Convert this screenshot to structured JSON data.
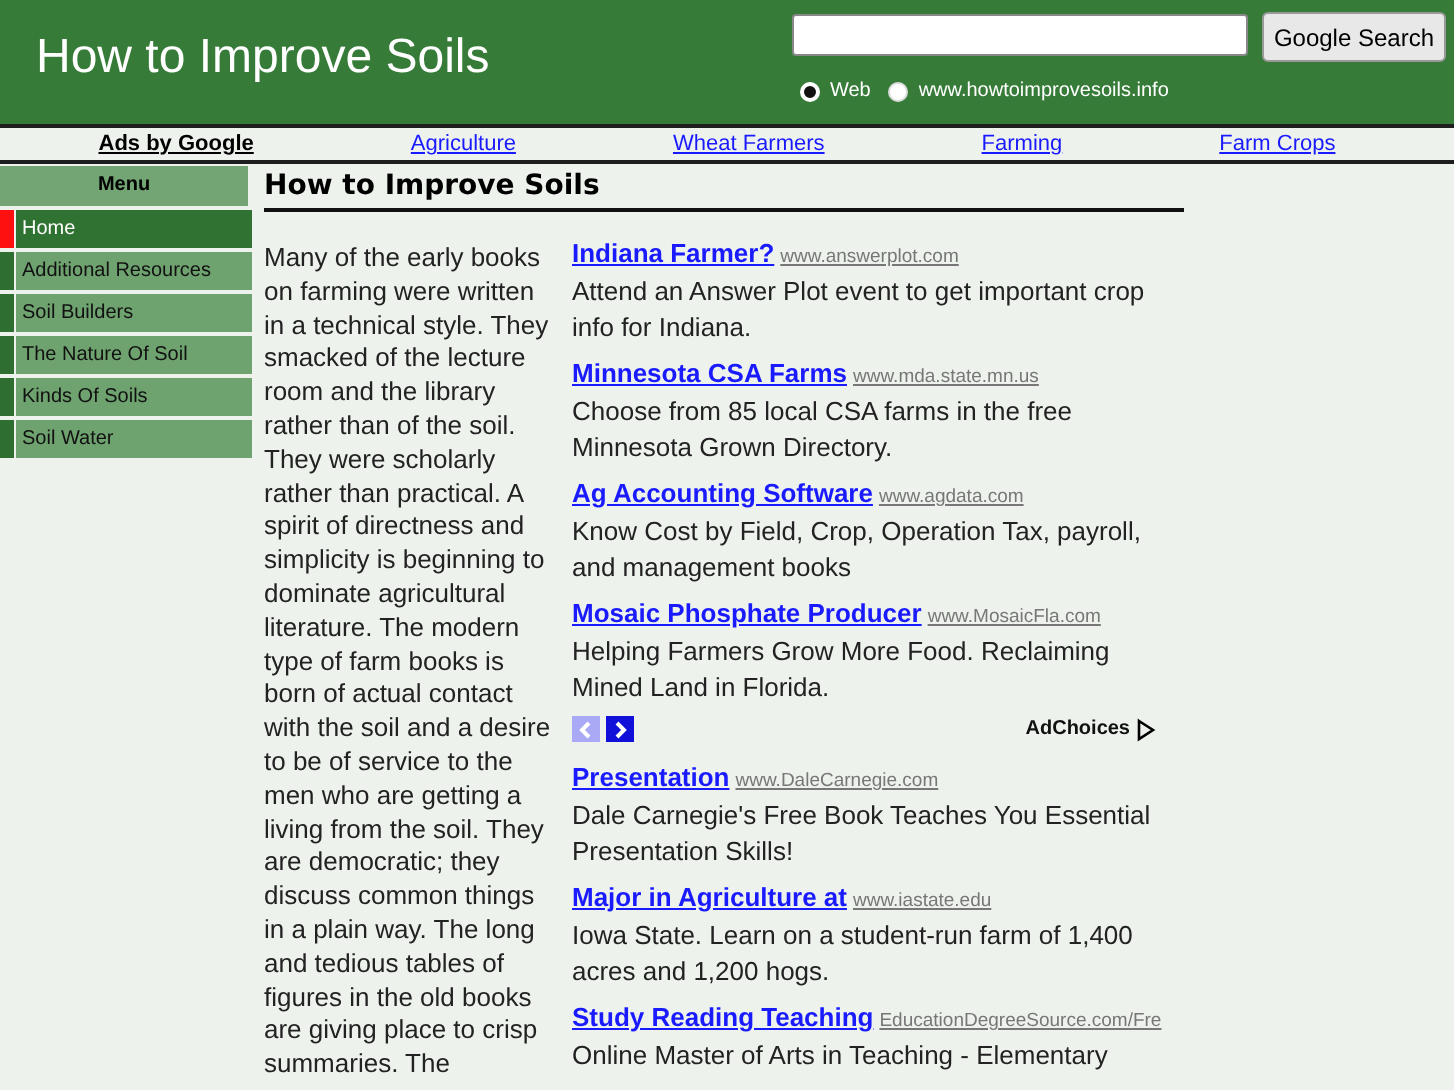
{
  "header": {
    "title": "How to Improve Soils",
    "search": {
      "button": "Google Search",
      "options": [
        {
          "label": "Web",
          "selected": true
        },
        {
          "label": "www.howtoimprovesoils.info",
          "selected": false
        }
      ]
    }
  },
  "nav": {
    "label": "Ads by Google",
    "links": [
      "Agriculture",
      "Wheat Farmers",
      "Farming",
      "Farm Crops"
    ]
  },
  "sidebar": {
    "heading": "Menu",
    "items": [
      {
        "label": "Home",
        "selected": true
      },
      {
        "label": "Additional Resources",
        "selected": false
      },
      {
        "label": "Soil Builders",
        "selected": false
      },
      {
        "label": "The Nature Of Soil",
        "selected": false
      },
      {
        "label": "Kinds Of Soils",
        "selected": false
      },
      {
        "label": "Soil Water",
        "selected": false
      }
    ]
  },
  "article": {
    "title": "How to Improve Soils",
    "body": "Many of the early books on farming were written in a technical style. They smacked of the lecture room and the library rather than of the soil. They were scholarly rather than practical. A spirit of directness and simplicity is beginning to dominate agricultural literature. The modern type of farm books is born of actual contact with the soil and a desire to be of service to the men who are getting a living from the soil. They are democratic; they discuss common things in a plain way. The long and tedious tables of figures in the old books are giving place to crisp summaries. The"
  },
  "ads": {
    "top": [
      {
        "title": "Indiana Farmer?",
        "url": "www.answerplot.com",
        "text": "Attend an Answer Plot event to get important crop info for Indiana."
      },
      {
        "title": "Minnesota CSA Farms",
        "url": "www.mda.state.mn.us",
        "text": "Choose from 85 local CSA farms in the free Minnesota Grown Directory."
      },
      {
        "title": "Ag Accounting Software",
        "url": "www.agdata.com",
        "text": "Know Cost by Field, Crop, Operation Tax, payroll, and management books"
      },
      {
        "title": "Mosaic Phosphate Producer",
        "url": "www.MosaicFla.com",
        "text": "Helping Farmers Grow More Food. Reclaiming Mined Land in Florida."
      }
    ],
    "adchoices": "AdChoices",
    "bottom": [
      {
        "title": "Presentation",
        "url": "www.DaleCarnegie.com",
        "text": "Dale Carnegie's Free Book Teaches You Essential Presentation Skills!"
      },
      {
        "title": "Major in Agriculture at",
        "url": "www.iastate.edu",
        "text": "Iowa State. Learn on a student-run farm of 1,400 acres and 1,200 hogs."
      },
      {
        "title": "Study Reading Teaching",
        "url": "EducationDegreeSource.com/Fre",
        "text": "Online Master of Arts in Teaching - Elementary"
      }
    ]
  }
}
